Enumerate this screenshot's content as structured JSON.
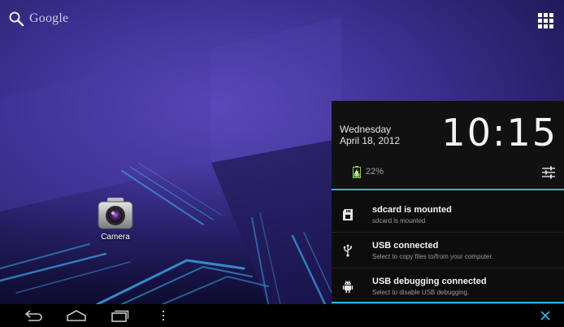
{
  "search": {
    "label": "Google"
  },
  "desktop": {
    "shortcuts": [
      {
        "label": "Camera",
        "icon": "camera-icon"
      }
    ]
  },
  "notification_panel": {
    "day": "Wednesday",
    "date": "April 18, 2012",
    "time": "10:15",
    "battery": "22%",
    "notifications": [
      {
        "icon": "sdcard-icon",
        "title": "sdcard is mounted",
        "subtitle": "sdcard is mounted"
      },
      {
        "icon": "usb-icon",
        "title": "USB connected",
        "subtitle": "Select to copy files to/from your computer."
      },
      {
        "icon": "android-debug-icon",
        "title": "USB debugging connected",
        "subtitle": "Select to disable USB debugging."
      }
    ]
  },
  "navbar": {
    "buttons": [
      "back-icon",
      "home-icon",
      "recent-apps-icon",
      "menu-icon",
      "close-icon"
    ]
  },
  "colors": {
    "accent": "#33b5e5",
    "wallpaper_top": "#3d3390",
    "wallpaper_bottom": "#141040",
    "panel_bg": "#0d0d0d"
  }
}
